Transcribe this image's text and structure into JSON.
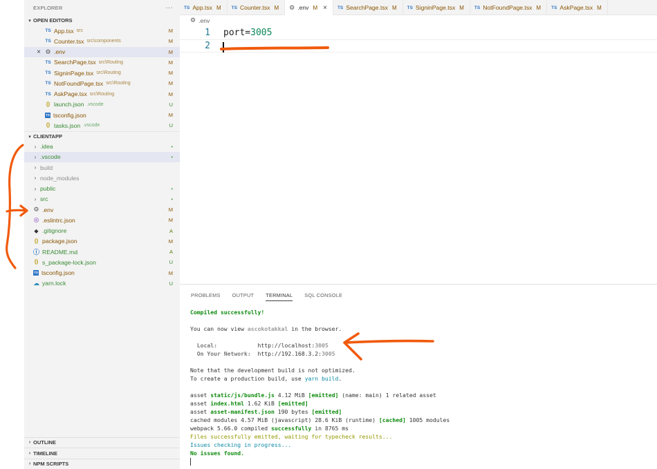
{
  "explorer": {
    "title": "EXPLORER",
    "more": "···",
    "open_editors": {
      "label": "OPEN EDITORS",
      "items": [
        {
          "icon": "TS",
          "name": "App.tsx",
          "desc": "src",
          "badge": "M"
        },
        {
          "icon": "TS",
          "name": "Counter.tsx",
          "desc": "src\\components",
          "badge": "M"
        },
        {
          "icon": "gear",
          "name": ".env",
          "desc": "",
          "badge": "M"
        },
        {
          "icon": "TS",
          "name": "SearchPage.tsx",
          "desc": "src\\Routing",
          "badge": "M"
        },
        {
          "icon": "TS",
          "name": "SigninPage.tsx",
          "desc": "src\\Routing",
          "badge": "M"
        },
        {
          "icon": "TS",
          "name": "NotFoundPage.tsx",
          "desc": "src\\Routing",
          "badge": "M"
        },
        {
          "icon": "TS",
          "name": "AskPage.tsx",
          "desc": "src\\Routing",
          "badge": "M"
        },
        {
          "icon": "{}",
          "name": "launch.json",
          "desc": ".vscode",
          "badge": "U"
        },
        {
          "icon": "TS",
          "name": "tsconfig.json",
          "desc": "",
          "badge": "M"
        },
        {
          "icon": "{}",
          "name": "tasks.json",
          "desc": ".vscode",
          "badge": "U"
        }
      ]
    },
    "project": {
      "label": "CLIENTAPP",
      "items": [
        {
          "name": ".idea",
          "badge": "•"
        },
        {
          "name": ".vscode",
          "badge": "•"
        },
        {
          "name": "build",
          "badge": ""
        },
        {
          "name": "node_modules",
          "badge": ""
        },
        {
          "name": "public",
          "badge": "•"
        },
        {
          "name": "src",
          "badge": "•"
        },
        {
          "name": ".env",
          "badge": "M"
        },
        {
          "name": ".eslintrc.json",
          "badge": "M"
        },
        {
          "name": ".gitignore",
          "badge": "A"
        },
        {
          "name": "package.json",
          "badge": "M"
        },
        {
          "name": "README.md",
          "badge": "A"
        },
        {
          "name": "s_package-lock.json",
          "badge": "U"
        },
        {
          "name": "tsconfig.json",
          "badge": "M"
        },
        {
          "name": "yarn.lock",
          "badge": "U"
        }
      ]
    },
    "outline": "OUTLINE",
    "timeline": "TIMELINE",
    "npm_scripts": "NPM SCRIPTS"
  },
  "tabs": [
    {
      "name": "App.tsx",
      "badge": "M"
    },
    {
      "name": "Counter.tsx",
      "badge": "M"
    },
    {
      "name": ".env",
      "badge": "M",
      "close": "×"
    },
    {
      "name": "SearchPage.tsx",
      "badge": "M"
    },
    {
      "name": "SigninPage.tsx",
      "badge": "M"
    },
    {
      "name": "NotFoundPage.tsx",
      "badge": "M"
    },
    {
      "name": "AskPage.tsx",
      "badge": "M"
    }
  ],
  "breadcrumb": ".env",
  "editor": {
    "line1_num": "1",
    "line1_key": "port=",
    "line1_val": "3005",
    "line2_num": "2"
  },
  "panel_tabs": {
    "problems": "PROBLEMS",
    "output": "OUTPUT",
    "terminal": "TERMINAL",
    "sql_console": "SQL CONSOLE"
  },
  "terminal": {
    "compiled": "Compiled successfully!",
    "view_a": "You can now view ",
    "view_app": "ascokotakkal",
    "view_b": " in the browser.",
    "local_label": "  Local:            ",
    "local_url_a": "http://localhost:",
    "local_url_port": "3005",
    "network_label": "  On Your Network:  ",
    "network_url_a": "http://192.168.3.2:",
    "network_url_port": "3005",
    "note1": "Note that the development build is not optimized.",
    "note2_a": "To create a production build, use ",
    "note2_cmd": "yarn build",
    "note2_b": ".",
    "asset1_a": "asset ",
    "asset1_file": "static/js/bundle.js",
    "asset1_b": " 4.12 MiB ",
    "asset1_tag": "[emitted]",
    "asset1_c": " (name: main) 1 related asset",
    "asset2_a": "asset ",
    "asset2_file": "index.html",
    "asset2_b": " 1.62 KiB ",
    "asset2_tag": "[emitted]",
    "asset3_a": "asset ",
    "asset3_file": "asset-manifest.json",
    "asset3_b": " 190 bytes ",
    "asset3_tag": "[emitted]",
    "cached_a": "cached modules 4.57 MiB (javascript) 28.6 KiB (runtime) ",
    "cached_tag": "[cached]",
    "cached_b": " 1005 modules",
    "webpack_a": "webpack 5.66.0 compiled ",
    "webpack_ok": "successfully",
    "webpack_b": " in 8765 ms",
    "files_emitted": "Files successfully emitted, waiting for typecheck results...",
    "issues_checking": "Issues checking in progress...",
    "no_issues": "No issues found."
  },
  "colors": {
    "annotation": "#f05a0c",
    "modified": "#895503",
    "untracked": "#388a34",
    "ts_blue": "#3178c6"
  }
}
